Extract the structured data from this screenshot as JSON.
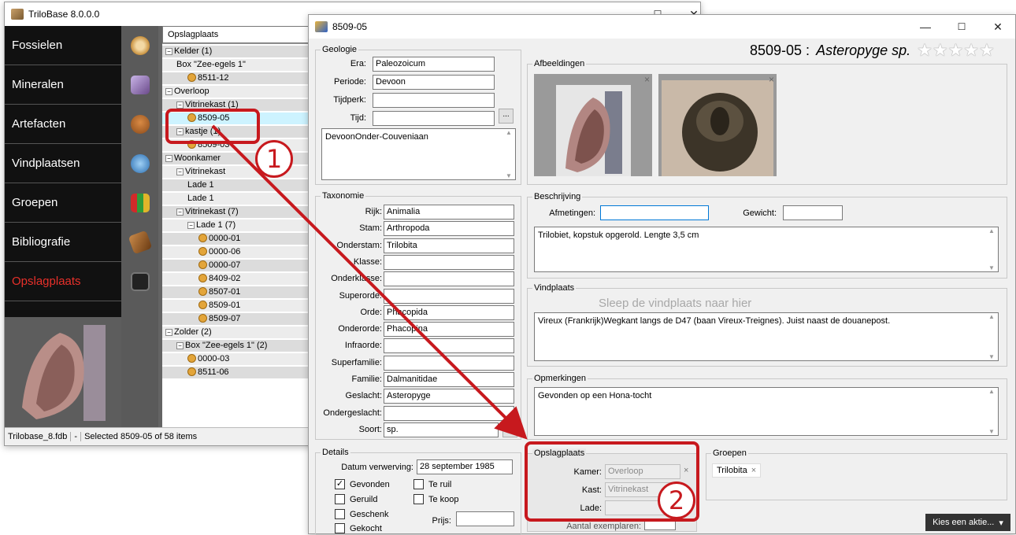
{
  "main_window": {
    "title": "TriloBase 8.0.0.0",
    "nav_items": [
      "Fossielen",
      "Mineralen",
      "Artefacten",
      "Vindplaatsen",
      "Groepen",
      "Bibliografie",
      "Opslagplaats"
    ],
    "tree_header": "Opslagplaats",
    "tree": [
      {
        "label": "Kelder (1)",
        "level": 0,
        "expander": "−",
        "icon": false
      },
      {
        "label": "Box \"Zee-egels 1\"",
        "level": 1,
        "expander": "",
        "icon": false
      },
      {
        "label": "8511-12",
        "level": 2,
        "expander": "",
        "icon": true
      },
      {
        "label": "Overloop",
        "level": 0,
        "expander": "−",
        "icon": false
      },
      {
        "label": "Vitrinekast (1)",
        "level": 1,
        "expander": "−",
        "icon": false
      },
      {
        "label": "8509-05",
        "level": 2,
        "expander": "",
        "icon": true,
        "selected": true
      },
      {
        "label": "kastje (1)",
        "level": 1,
        "expander": "−",
        "icon": false
      },
      {
        "label": "8509-03",
        "level": 2,
        "expander": "",
        "icon": true
      },
      {
        "label": "Woonkamer",
        "level": 0,
        "expander": "−",
        "icon": false
      },
      {
        "label": "Vitrinekast",
        "level": 1,
        "expander": "−",
        "icon": false
      },
      {
        "label": "Lade 1",
        "level": 2,
        "expander": "",
        "icon": false
      },
      {
        "label": "Lade 1",
        "level": 2,
        "expander": "",
        "icon": false
      },
      {
        "label": "Vitrinekast (7)",
        "level": 1,
        "expander": "−",
        "icon": false
      },
      {
        "label": "Lade 1 (7)",
        "level": 2,
        "expander": "−",
        "icon": false
      },
      {
        "label": "0000-01",
        "level": 3,
        "expander": "",
        "icon": true
      },
      {
        "label": "0000-06",
        "level": 3,
        "expander": "",
        "icon": true
      },
      {
        "label": "0000-07",
        "level": 3,
        "expander": "",
        "icon": true
      },
      {
        "label": "8409-02",
        "level": 3,
        "expander": "",
        "icon": true
      },
      {
        "label": "8507-01",
        "level": 3,
        "expander": "",
        "icon": true
      },
      {
        "label": "8509-01",
        "level": 3,
        "expander": "",
        "icon": true
      },
      {
        "label": "8509-07",
        "level": 3,
        "expander": "",
        "icon": true
      },
      {
        "label": "Zolder (2)",
        "level": 0,
        "expander": "−",
        "icon": false
      },
      {
        "label": "Box \"Zee-egels 1\" (2)",
        "level": 1,
        "expander": "−",
        "icon": false
      },
      {
        "label": "0000-03",
        "level": 2,
        "expander": "",
        "icon": true
      },
      {
        "label": "8511-06",
        "level": 2,
        "expander": "",
        "icon": true
      }
    ],
    "status": {
      "file": "Trilobase_8.fdb",
      "sep": "-",
      "selection": "Selected 8509-05 of 58 items"
    }
  },
  "detail_window": {
    "title": "8509-05",
    "header_id": "8509-05 :",
    "header_species": "Asteropyge sp.",
    "stars": "★★★★★",
    "geologie": {
      "label": "Geologie",
      "fields": [
        {
          "label": "Era:",
          "value": "Paleozoicum"
        },
        {
          "label": "Periode:",
          "value": "Devoon"
        },
        {
          "label": "Tijdperk:",
          "value": ""
        },
        {
          "label": "Tijd:",
          "value": ""
        }
      ],
      "dots": "...",
      "notes": "DevoonOnder-Couveniaan"
    },
    "taxonomie": {
      "label": "Taxonomie",
      "fields": [
        {
          "label": "Rijk:",
          "value": "Animalia"
        },
        {
          "label": "Stam:",
          "value": "Arthropoda"
        },
        {
          "label": "Onderstam:",
          "value": "Trilobita"
        },
        {
          "label": "Klasse:",
          "value": ""
        },
        {
          "label": "Onderklasse:",
          "value": ""
        },
        {
          "label": "Superorde:",
          "value": ""
        },
        {
          "label": "Orde:",
          "value": "Phacopida"
        },
        {
          "label": "Onderorde:",
          "value": "Phacopina"
        },
        {
          "label": "Infraorde:",
          "value": ""
        },
        {
          "label": "Superfamilie:",
          "value": ""
        },
        {
          "label": "Familie:",
          "value": "Dalmanitidae"
        },
        {
          "label": "Geslacht:",
          "value": "Asteropyge"
        },
        {
          "label": "Ondergeslacht:",
          "value": ""
        },
        {
          "label": "Soort:",
          "value": "sp."
        }
      ],
      "dots": "..."
    },
    "details": {
      "label": "Details",
      "datum_label": "Datum verwerving:",
      "datum_value": "28 september 1985",
      "checks": [
        {
          "label": "Gevonden",
          "checked": true
        },
        {
          "label": "Geruild",
          "checked": false
        },
        {
          "label": "Geschenk",
          "checked": false
        },
        {
          "label": "Gekocht",
          "checked": false
        },
        {
          "label": "Te ruil",
          "checked": false
        },
        {
          "label": "Te koop",
          "checked": false
        }
      ],
      "check_mark": "✓",
      "prijs_label": "Prijs:",
      "prijs_value": ""
    },
    "afbeeldingen": {
      "label": "Afbeeldingen",
      "close": "×"
    },
    "beschrijving": {
      "label": "Beschrijving",
      "afmetingen_label": "Afmetingen:",
      "afmetingen_value": "",
      "gewicht_label": "Gewicht:",
      "gewicht_value": "",
      "text": "Trilobiet, kopstuk opgerold. Lengte 3,5 cm"
    },
    "vindplaats": {
      "label": "Vindplaats",
      "hint": "Sleep de vindplaats naar hier",
      "text": "Vireux (Frankrijk)Wegkant langs de D47 (baan Vireux-Treignes). Juist naast de douanepost."
    },
    "opmerkingen": {
      "label": "Opmerkingen",
      "text": "Gevonden op een Hona-tocht"
    },
    "opslagplaats": {
      "label": "Opslagplaats",
      "kamer_label": "Kamer:",
      "kamer_value": "Overloop",
      "kast_label": "Kast:",
      "kast_value": "Vitrinekast",
      "lade_label": "Lade:",
      "lade_value": "",
      "clear": "×",
      "extra_label": "Aantal exemplaren:"
    },
    "groepen": {
      "label": "Groepen",
      "tag": "Trilobita",
      "tag_close": "×"
    },
    "action_button": "Kies een aktie...",
    "action_arrow": "▾"
  },
  "window_controls": {
    "minimize": "—",
    "maximize": "☐",
    "close": "✕"
  },
  "annotations": [
    "1",
    "2"
  ],
  "colors": {
    "accent_red": "#c7191e",
    "nav_active": "#e8302a",
    "selection": "#cdf3ff"
  }
}
